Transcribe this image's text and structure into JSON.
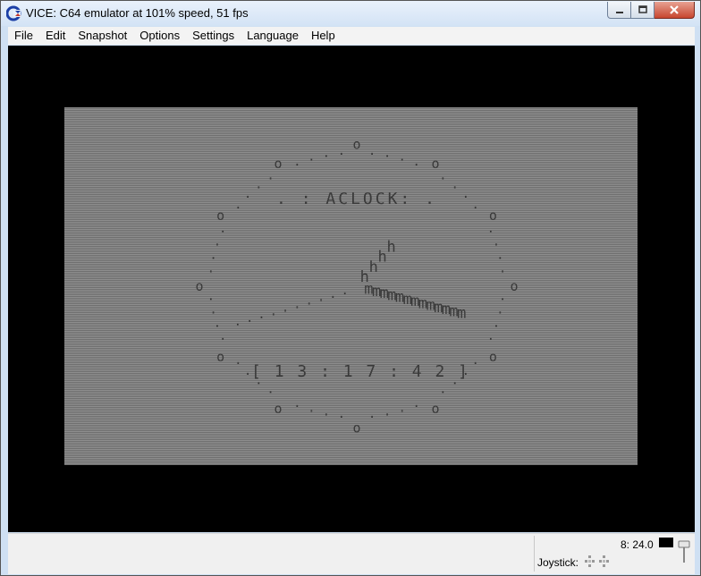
{
  "window": {
    "title": "VICE: C64 emulator at 101% speed, 51 fps"
  },
  "menubar": {
    "items": [
      "File",
      "Edit",
      "Snapshot",
      "Options",
      "Settings",
      "Language",
      "Help"
    ]
  },
  "c64_screen": {
    "heading": ". : ACLOCK: .",
    "clock_time": "[ 1 3 : 1 7 : 4 2 ]",
    "hour_hand_char": "h",
    "minute_hand_char": "m",
    "second_hand_char": ".",
    "tick_char": "o",
    "dial_char": ".",
    "colors": {
      "border": "#000000",
      "screen_light": "#8e8e8e",
      "screen_dark": "#6f6f6f",
      "text": "#3a3a3a"
    }
  },
  "statusbar": {
    "drive_status": "8: 24.0",
    "joystick_label": "Joystick:"
  }
}
